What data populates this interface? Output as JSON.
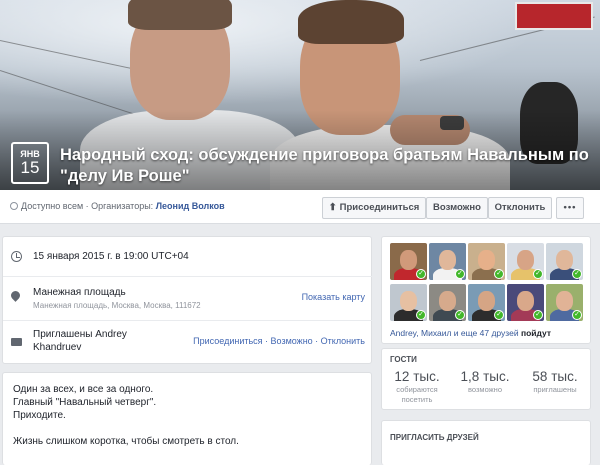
{
  "event": {
    "month": "ЯНВ",
    "day": "15",
    "title": "Народный сход: обсуждение приговора братьям Навальным по \"делу Ив Роше\""
  },
  "meta": {
    "visibility": "Доступно всем · Организаторы:",
    "organizer": "Леонид Волков"
  },
  "actions": {
    "join": "Присоединиться",
    "maybe": "Возможно",
    "decline": "Отклонить",
    "more": "•••"
  },
  "details": {
    "datetime": "15 января 2015 г. в 19:00 UTC+04",
    "place": "Манежная площадь",
    "address": "Манежная площадь, Москва, Москва, 111672",
    "show_map": "Показать карту",
    "invited_line1": "Приглашены Andrey",
    "invited_line2": "Khandruev",
    "rsvp_links": "Присоединиться · Возможно · Отклонить"
  },
  "description": {
    "line1": "Один за всех, и все за одного.",
    "line2": "Главный \"Навальный четверг\".",
    "line3": "Приходите.",
    "line4": "Жизнь слишком коротка, чтобы смотреть в стол."
  },
  "friends": {
    "names": "Andrey, Михаил и еще 47 друзей",
    "going": "пойдут",
    "avatar_colors": [
      {
        "bg": "#8a6a4a",
        "head": "#d19a7a",
        "body": "#c1272d"
      },
      {
        "bg": "#6e87a3",
        "head": "#e0b79a",
        "body": "#f2f2f2"
      },
      {
        "bg": "#c9b08d",
        "head": "#e6b08a",
        "body": "#8b6f4e"
      },
      {
        "bg": "#d8dde4",
        "head": "#d7a486",
        "body": "#e6c26a"
      },
      {
        "bg": "#cfd7df",
        "head": "#e0b79a",
        "body": "#3a4f7a"
      },
      {
        "bg": "#bfc7cf",
        "head": "#e6c0a2",
        "body": "#2c2c2c"
      },
      {
        "bg": "#8c8a84",
        "head": "#d6aa8c",
        "body": "#3f4a52"
      },
      {
        "bg": "#7a9bb5",
        "head": "#d5a585",
        "body": "#2d2d2d"
      },
      {
        "bg": "#4a4a7a",
        "head": "#d9a88a",
        "body": "#a33a57"
      },
      {
        "bg": "#9ab06c",
        "head": "#e1b396",
        "body": "#4f6aa0"
      }
    ]
  },
  "guests": {
    "heading": "ГОСТИ",
    "going_count": "12 тыс.",
    "going_label1": "собираются",
    "going_label2": "посетить",
    "maybe_count": "1,8 тыс.",
    "maybe_label": "возможно",
    "invited_count": "58 тыс.",
    "invited_label": "приглашены"
  },
  "invite": {
    "heading": "ПРИГЛАСИТЬ ДРУЗЕЙ"
  }
}
